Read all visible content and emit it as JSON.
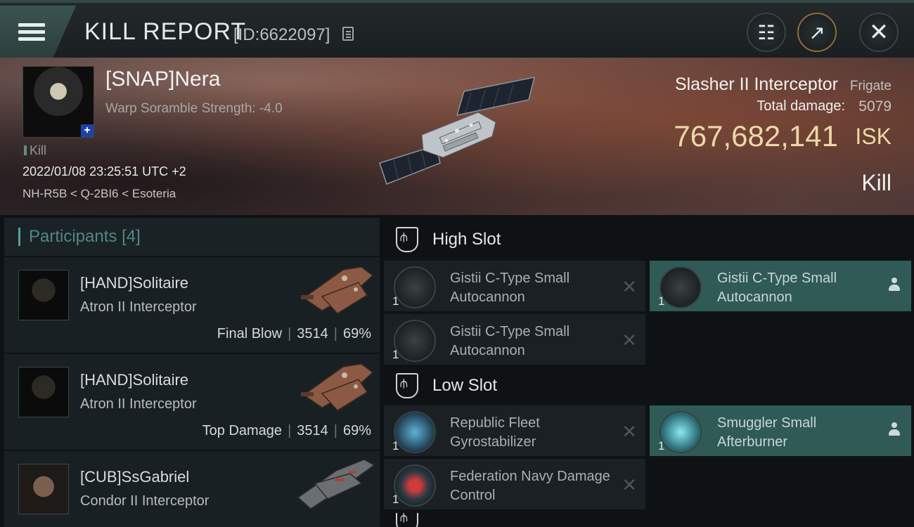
{
  "header": {
    "title": "KILL REPORT",
    "kill_id": "[ID:6622097]"
  },
  "victim": {
    "name": "[SNAP]Nera",
    "warp": "Warp Soramble Strength: -4.0",
    "kill_label": "Kill",
    "time": "2022/01/08 23:25:51 UTC +2",
    "location": "NH-R5B < Q-2BI6 < Esoteria",
    "ship_name": "Slasher II Interceptor",
    "ship_class": "Frigate",
    "damage_label": "Total damage:",
    "damage_value": "5079",
    "isk_value": "767,682,141",
    "isk_unit": "ISK",
    "result": "Kill"
  },
  "participants": {
    "title": "Participants",
    "count": "[4]",
    "rows": [
      {
        "name": "[HAND]Solitaire",
        "ship": "Atron II Interceptor",
        "tag": "Final Blow",
        "damage": "3514",
        "percent": "69%"
      },
      {
        "name": "[HAND]Solitaire",
        "ship": "Atron II Interceptor",
        "tag": "Top Damage",
        "damage": "3514",
        "percent": "69%"
      },
      {
        "name": "[CUB]SsGabriel",
        "ship": "Condor II Interceptor"
      }
    ]
  },
  "slots": {
    "high": {
      "label": "High Slot",
      "modules": [
        {
          "name": "Gistii C-Type Small Autocannon",
          "qty": "1"
        },
        {
          "name": "Gistii C-Type Small Autocannon",
          "qty": "1"
        },
        {
          "name": "Gistii C-Type Small Autocannon",
          "qty": "1"
        }
      ]
    },
    "low": {
      "label": "Low Slot",
      "modules": [
        {
          "name": "Republic Fleet Gyrostabilizer",
          "qty": "1"
        },
        {
          "name": "Smuggler Small Afterburner",
          "qty": "1"
        },
        {
          "name": "Federation Navy Damage Control",
          "qty": "1"
        }
      ]
    }
  },
  "colors": {
    "accent_teal": "#2f5a55",
    "isk_gold": "#ecd9a6",
    "participants_title": "#4f8886"
  }
}
